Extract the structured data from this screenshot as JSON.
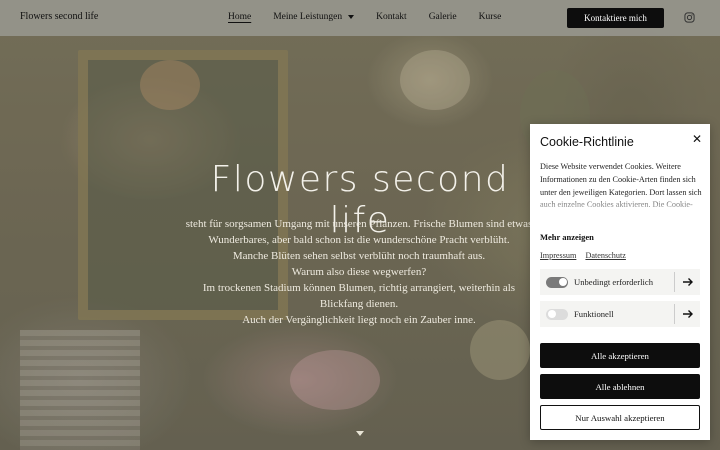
{
  "header": {
    "brand": "Flowers second life",
    "nav": [
      {
        "label": "Home",
        "active": true
      },
      {
        "label": "Meine Leistungen",
        "dropdown": true
      },
      {
        "label": "Kontakt"
      },
      {
        "label": "Galerie"
      },
      {
        "label": "Kurse"
      }
    ],
    "cta_label": "Kontaktiere mich",
    "social_icon": "instagram-icon"
  },
  "hero": {
    "title": "Flowers second life",
    "lines": [
      "steht für sorgsamen Umgang mit unseren Pflanzen. Frische Blumen sind etwas",
      "Wunderbares, aber bald schon ist die wunderschöne Pracht verblüht.",
      "Manche Blüten sehen selbst verblüht noch traumhaft aus.",
      "Warum also diese wegwerfen?",
      "Im trockenen Stadium können Blumen, richtig arrangiert, weiterhin als",
      "Blickfang dienen.",
      "Auch der Vergänglichkeit liegt noch ein Zauber inne."
    ]
  },
  "cookie": {
    "title": "Cookie-Richtlinie",
    "text": "Diese Website verwendet Cookies. Weitere Informationen zu den Cookie-Arten finden sich unter den jeweiligen Kategorien. Dort lassen sich auch einzelne Cookies aktivieren. Die Cookie-",
    "more_label": "Mehr anzeigen",
    "links": [
      "Impressum",
      "Datenschutz"
    ],
    "categories": [
      {
        "label": "Unbedingt erforderlich",
        "enabled": true
      },
      {
        "label": "Funktionell",
        "enabled": false
      }
    ],
    "buttons": {
      "accept_all": "Alle akzeptieren",
      "reject_all": "Alle ablehnen",
      "accept_selection": "Nur Auswahl akzeptieren"
    }
  },
  "colors": {
    "header_bg": "#96948c",
    "button_dark": "#0d0d0d",
    "toggle_on": "#7a7a7a",
    "toggle_off": "#dcdcdc"
  }
}
